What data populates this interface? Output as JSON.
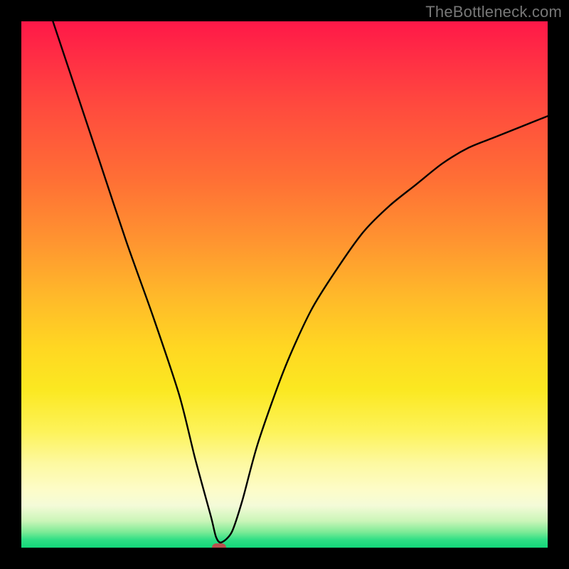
{
  "watermark": "TheBottleneck.com",
  "chart_data": {
    "type": "line",
    "title": "",
    "xlabel": "",
    "ylabel": "",
    "xlim": [
      0,
      100
    ],
    "ylim": [
      0,
      100
    ],
    "grid": false,
    "legend": false,
    "series": [
      {
        "name": "bottleneck-curve",
        "x": [
          6,
          10,
          15,
          20,
          25,
          30,
          33,
          36,
          37,
          38,
          40,
          42,
          45,
          50,
          55,
          60,
          65,
          70,
          75,
          80,
          85,
          90,
          95,
          100
        ],
        "values": [
          100,
          88,
          73,
          58,
          44,
          29,
          17,
          6,
          2,
          1,
          3,
          9,
          20,
          34,
          45,
          53,
          60,
          65,
          69,
          73,
          76,
          78,
          80,
          82
        ]
      }
    ],
    "annotations": [
      {
        "name": "notch-marker",
        "x": 37.5,
        "y": 0,
        "color": "#b9514e"
      }
    ]
  },
  "colors": {
    "curve": "#000000",
    "marker": "#b9514e",
    "frame": "#000000"
  }
}
